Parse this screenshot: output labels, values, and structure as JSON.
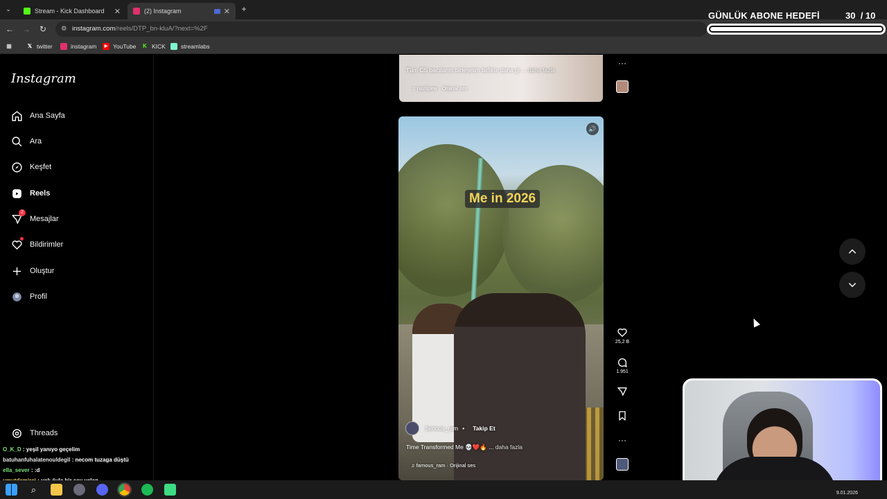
{
  "browser": {
    "tabs": [
      {
        "label": "Stream - Kick Dashboard",
        "favicon_color": "#53fc18",
        "active": false
      },
      {
        "label": "(2) Instagram",
        "favicon_color": "#e1306c",
        "active": true
      }
    ],
    "new_tab_icon": "plus-icon",
    "url_host": "instagram.com",
    "url_path": "/reels/DTP_bn-kluA/?next=%2F",
    "bookmarks": [
      {
        "label": "twitter",
        "icon": "x-logo-icon",
        "color": "#ffffff"
      },
      {
        "label": "instagram",
        "icon": "instagram-icon",
        "color": "#e1306c"
      },
      {
        "label": "YouTube",
        "icon": "youtube-icon",
        "color": "#ff0000"
      },
      {
        "label": "KICK",
        "icon": "kick-icon",
        "color": "#53fc18"
      },
      {
        "label": "streamlabs",
        "icon": "streamlabs-icon",
        "color": "#80f5d2"
      }
    ]
  },
  "overlay": {
    "goal_title": "GÜNLÜK ABONE HEDEFİ",
    "goal_current": "30",
    "goal_target": "/ 10",
    "goal_progress": 1.0
  },
  "instagram": {
    "logo": "Instagram",
    "nav": [
      {
        "label": "Ana Sayfa",
        "icon": "home-icon"
      },
      {
        "label": "Ara",
        "icon": "search-icon"
      },
      {
        "label": "Keşfet",
        "icon": "compass-icon"
      },
      {
        "label": "Reels",
        "icon": "reels-icon",
        "active": true
      },
      {
        "label": "Mesajlar",
        "icon": "messenger-icon",
        "badge": "2"
      },
      {
        "label": "Bildirimler",
        "icon": "heart-icon",
        "dot": true
      },
      {
        "label": "Oluştur",
        "icon": "plus-icon"
      },
      {
        "label": "Profil",
        "icon": "avatar-icon"
      }
    ],
    "threads_label": "Threads",
    "prev_reel": {
      "caption": "Tüm CS bacılarım birleşelim birlikte daha gi ...",
      "more": "daha fazla",
      "audio": "nazlipew · Orijinal ses"
    },
    "reel": {
      "overlay_text": "Me in 2026",
      "username": "famous_ram",
      "separator": "•",
      "follow": "Takip Et",
      "caption": "Time Transformed Me 💀❤️🔥 ...",
      "more": "daha fazla",
      "audio": "famous_ram · Orijinal ses",
      "likes": "25,2 B",
      "comments": "1.951"
    }
  },
  "chat": [
    {
      "user": "O_K_D",
      "message": ": yeşil yanıyo geçelim"
    },
    {
      "user": "batuhanfuhalatenouldegil",
      "message": ": necom tuzaga düştü"
    },
    {
      "user": "ella_sever",
      "message": ": :d"
    },
    {
      "user": "umutdemirci",
      "message": ": yok öyle bir şey yalan"
    }
  ],
  "taskbar": {
    "date": "9.01.2026",
    "time": ""
  }
}
